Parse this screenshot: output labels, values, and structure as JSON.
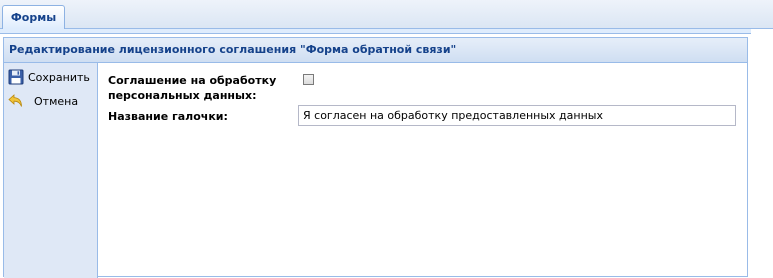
{
  "tabs": [
    {
      "label": "Формы"
    }
  ],
  "panel": {
    "title": "Редактирование лицензионного соглашения \"Форма обратной связи\""
  },
  "sidebar": {
    "save_label": "Сохранить",
    "cancel_label": "Отмена",
    "save_icon": "save-icon",
    "cancel_icon": "undo-arrow-icon"
  },
  "form": {
    "agreement_label_line1": "Соглашение на обработку",
    "agreement_label_line2": "персональных данных:",
    "agreement_checked": false,
    "checkbox_name_label": "Название галочки:",
    "checkbox_name_value": "Я согласен на обработку предоставленных данных"
  },
  "colors": {
    "accent": "#15428b",
    "border": "#99bbe8",
    "sidebar_bg": "#dfe8f6"
  }
}
